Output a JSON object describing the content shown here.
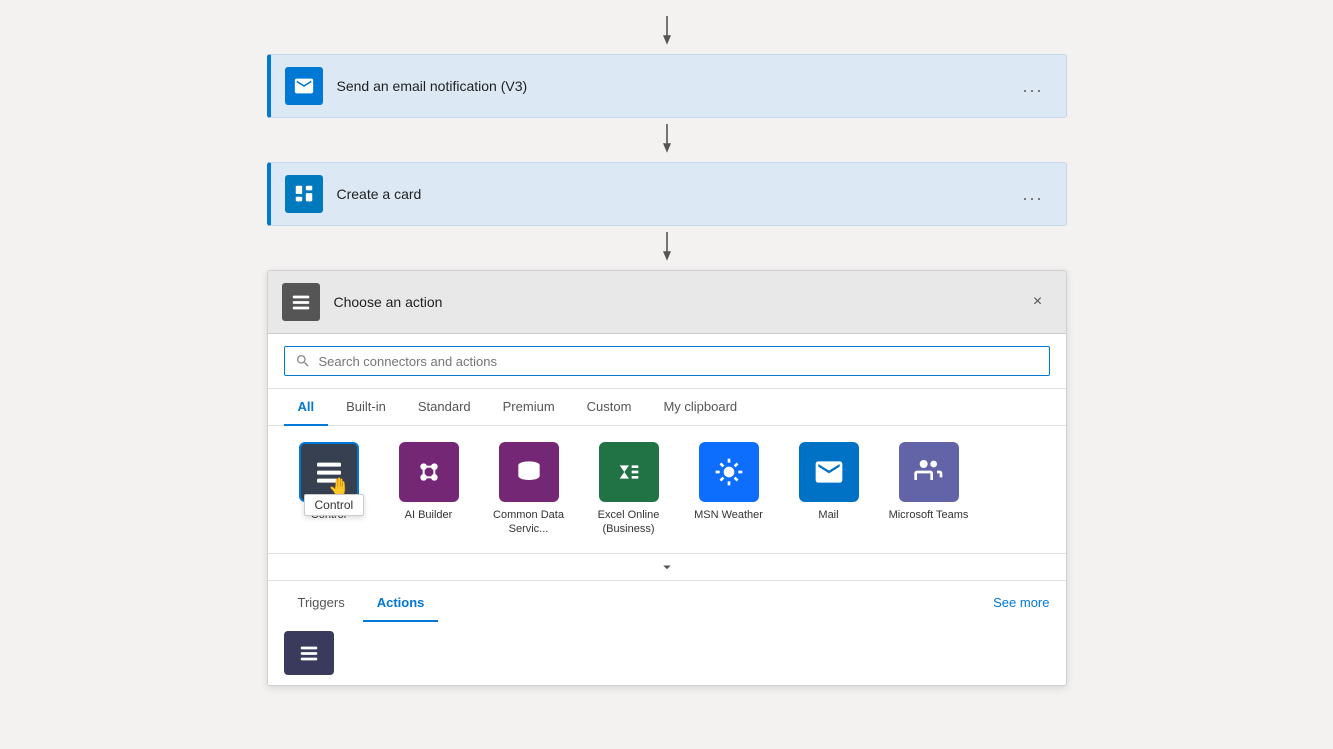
{
  "steps": [
    {
      "id": "email",
      "label": "Send an email notification (V3)",
      "icon": "email",
      "more": "..."
    },
    {
      "id": "card",
      "label": "Create a card",
      "icon": "trello",
      "more": "..."
    }
  ],
  "chooseAction": {
    "title": "Choose an action",
    "closeLabel": "×",
    "search": {
      "placeholder": "Search connectors and actions"
    },
    "tabs": [
      {
        "id": "all",
        "label": "All",
        "active": true
      },
      {
        "id": "built-in",
        "label": "Built-in",
        "active": false
      },
      {
        "id": "standard",
        "label": "Standard",
        "active": false
      },
      {
        "id": "premium",
        "label": "Premium",
        "active": false
      },
      {
        "id": "custom",
        "label": "Custom",
        "active": false
      },
      {
        "id": "clipboard",
        "label": "My clipboard",
        "active": false
      }
    ],
    "connectors": [
      {
        "id": "control",
        "name": "Control",
        "bg": "dark",
        "selected": true,
        "tooltip": "Control"
      },
      {
        "id": "ai-builder",
        "name": "AI Builder",
        "bg": "purple",
        "selected": false,
        "tooltip": ""
      },
      {
        "id": "dataverse",
        "name": "Common Data Servic...",
        "bg": "blue-db",
        "selected": false,
        "tooltip": ""
      },
      {
        "id": "excel",
        "name": "Excel Online (Business)",
        "bg": "green",
        "selected": false,
        "tooltip": ""
      },
      {
        "id": "msn-weather",
        "name": "MSN Weather",
        "bg": "teal",
        "selected": false,
        "tooltip": ""
      },
      {
        "id": "mail",
        "name": "Mail",
        "bg": "mail",
        "selected": false,
        "tooltip": ""
      },
      {
        "id": "teams",
        "name": "Microsoft Teams",
        "bg": "teams",
        "selected": false,
        "tooltip": ""
      }
    ],
    "bottomTabs": [
      {
        "id": "triggers",
        "label": "Triggers",
        "active": false
      },
      {
        "id": "actions",
        "label": "Actions",
        "active": true
      }
    ],
    "seeMore": "See more"
  }
}
